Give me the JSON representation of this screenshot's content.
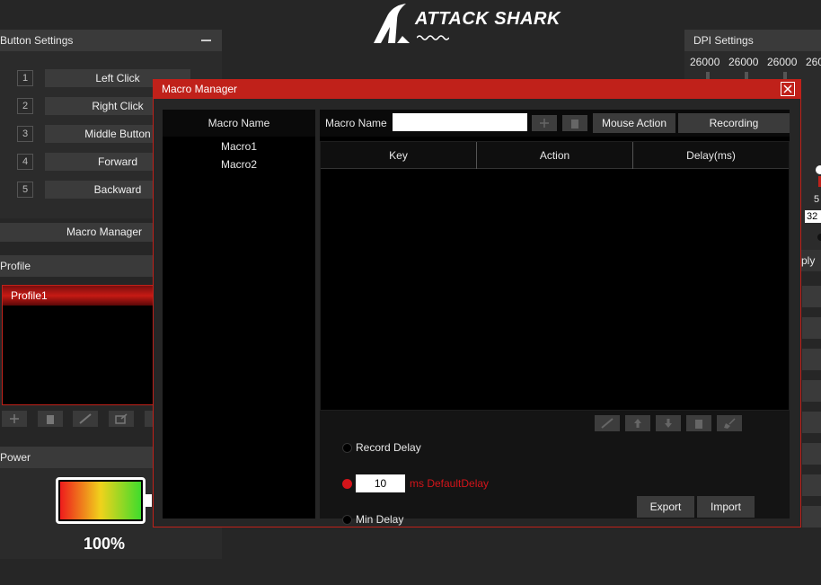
{
  "brand": {
    "logo_text": "ATTACK SHARK"
  },
  "button_settings": {
    "title": "Button Settings",
    "items": [
      {
        "num": "1",
        "label": "Left Click"
      },
      {
        "num": "2",
        "label": "Right Click"
      },
      {
        "num": "3",
        "label": "Middle Button"
      },
      {
        "num": "4",
        "label": "Forward"
      },
      {
        "num": "5",
        "label": "Backward"
      }
    ],
    "macro_manager_label": "Macro Manager"
  },
  "profile": {
    "title": "Profile",
    "items": [
      "Profile1"
    ]
  },
  "power": {
    "title": "Power",
    "percent": "100%",
    "level": 1.0
  },
  "dpi_settings": {
    "title": "DPI Settings",
    "values": [
      "26000",
      "26000",
      "26000",
      "260"
    ],
    "side_value_a": "5",
    "side_value_b": "32"
  },
  "apply_label": "ply",
  "macro_manager": {
    "title": "Macro Manager",
    "list_header": "Macro Name",
    "macros": [
      "Macro1",
      "Macro2"
    ],
    "name_label": "Macro Name",
    "name_value": "",
    "mouse_action_label": "Mouse Action",
    "recording_label": "Recording",
    "columns": [
      "Key",
      "Action",
      "Delay(ms)"
    ],
    "options": {
      "record_delay": "Record Delay",
      "default_delay_value": "10",
      "default_delay_label": "ms DefaultDelay",
      "min_delay": "Min Delay"
    },
    "export_label": "Export",
    "import_label": "Import"
  },
  "colors": {
    "accent": "#c0211a",
    "panel": "#3a3a3a",
    "bg": "#262626"
  },
  "icons": [
    "plus-icon",
    "trash-icon",
    "edit-icon",
    "arrow-up-icon",
    "arrow-down-icon",
    "broom-icon",
    "close-icon",
    "minimize-icon"
  ]
}
